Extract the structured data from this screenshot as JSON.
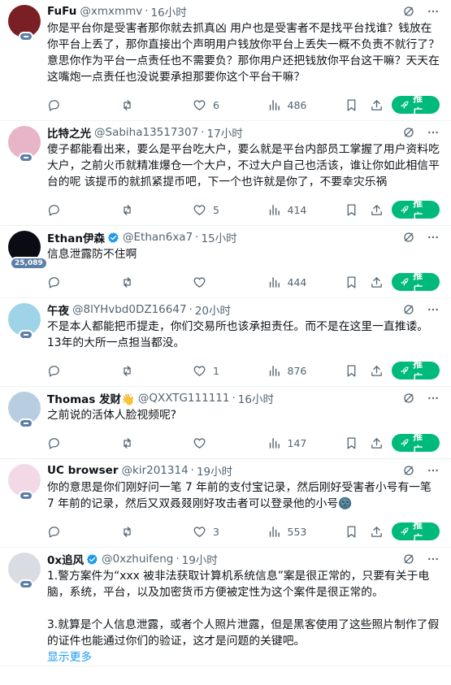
{
  "tweets": [
    {
      "name": "FuFu",
      "handle": "@xmxmmv",
      "time": "16小时",
      "text": "你是平台你是受害者那你就去抓真凶 用户也是受害者不是找平台找谁？钱放在你平台上丢了，那你直接出个声明用户钱放你平台上丢失一概不负责不就行了？意思你作为平台一点责任也不需要负？那你用户还把钱放你平台这干嘛？天天在这嘴炮一点责任也没说要承担那要你这个平台干嘛？",
      "reply_count": "",
      "retweet_count": "",
      "like_count": "6",
      "views": "486",
      "avatar_color": "#7a1f24",
      "badge": ""
    },
    {
      "name": "比特之光",
      "handle": "@Sabiha13517307",
      "time": "17小时",
      "text": "傻子都能看出来，要么是平台吃大户，要么就是平台内部员工掌握了用户资料吃大户，之前火币就精准爆仓一个大户，不过大户自己也活该，谁让你如此相信平台的呢 该提币的就抓紧提币吧，下一个也许就是你了，不要幸灾乐祸",
      "reply_count": "",
      "retweet_count": "",
      "like_count": "5",
      "views": "414",
      "avatar_color": "#e8b4c8",
      "badge": ""
    },
    {
      "name": "Ethan伊森",
      "handle": "@Ethan6xa7",
      "time": "15小时",
      "text": "信息泄露防不住啊",
      "reply_count": "",
      "retweet_count": "",
      "like_count": "",
      "views": "444",
      "avatar_color": "#0b0b14",
      "badge": "25,089"
    },
    {
      "name": "午夜",
      "handle": "@8lYHvbd0DZ16647",
      "time": "20小时",
      "text": "不是本人都能把币提走，你们交易所也该承担责任。而不是在这里一直推诿。13年的大所一点担当都没。",
      "reply_count": "",
      "retweet_count": "",
      "like_count": "1",
      "views": "876",
      "avatar_color": "#9fd3e8",
      "badge": ""
    },
    {
      "name": "Thomas 发财👋",
      "handle": "@QXXTG111111",
      "time": "16小时",
      "text": "之前说的活体人脸视频呢?",
      "reply_count": "",
      "retweet_count": "",
      "like_count": "",
      "views": "147",
      "avatar_color": "#b9cde0",
      "badge": ""
    },
    {
      "name": "UC browser",
      "handle": "@kir201314",
      "time": "19小时",
      "text": "你的意思是你们刚好问一笔 7 年前的支付宝记录，然后刚好受害者小号有一笔 7 年前的记录，然后又双叒叕刚好攻击者可以登录他的小号🌚",
      "reply_count": "",
      "retweet_count": "",
      "like_count": "3",
      "views": "553",
      "avatar_color": "#f3d9e6",
      "badge": ""
    },
    {
      "name": "0x追风",
      "handle": "@0xzhuifeng",
      "time": "19小时",
      "text": "1.警方案件为“xxx 被非法获取计算机系统信息”案是很正常的，只要有关于电脑，系统，平台，以及加密货币方便被定性为这个案件是很正常的。\n\n3.就算是个人信息泄露，或者个人照片泄露，但是黑客使用了这些照片制作了假的证件也能通过你们的验证，这才是问题的关键吧。",
      "show_more": "显示更多",
      "reply_count": "",
      "retweet_count": "",
      "like_count": "",
      "views": "",
      "avatar_color": "#d9dde3",
      "badge": ""
    }
  ],
  "labels": {
    "promote": "推广",
    "dot": "·"
  },
  "colors": {
    "promote_green": "#00ba7c",
    "link_blue": "#1d9bf0",
    "muted": "#536471",
    "verified_blue": "#1d9bf0"
  },
  "icons": [
    "grok-icon",
    "more-icon",
    "reply-icon",
    "retweet-icon",
    "like-icon",
    "views-icon",
    "bookmark-icon",
    "share-icon",
    "rocket-icon",
    "verified-icon"
  ]
}
